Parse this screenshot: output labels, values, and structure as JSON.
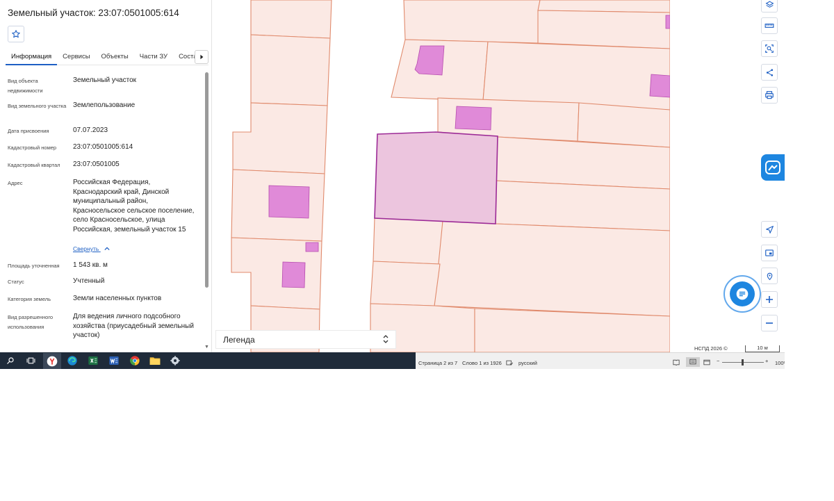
{
  "panel": {
    "title": "Земельный участок: 23:07:0501005:614",
    "tabs": [
      {
        "label": "Информация",
        "active": true
      },
      {
        "label": "Сервисы",
        "active": false
      },
      {
        "label": "Объекты",
        "active": false
      },
      {
        "label": "Части ЗУ",
        "active": false
      },
      {
        "label": "Состав",
        "active": false
      }
    ],
    "properties": [
      {
        "label": "Вид объекта недвижимости",
        "value": "Земельный участок"
      },
      {
        "label": "Вид земельного участка",
        "value": "Землепользование"
      },
      {
        "label": "Дата присвоения",
        "value": "07.07.2023"
      },
      {
        "label": "Кадастровый номер",
        "value": "23:07:0501005:614"
      },
      {
        "label": "Кадастровый квартал",
        "value": "23:07:0501005"
      },
      {
        "label": "Адрес",
        "value": "Российская Федерация, Краснодарский край, Динской муниципальный район, Красносельское сельское поселение, село Красносельское, улица Российская, земельный участок 15"
      },
      {
        "label": "Площадь уточненная",
        "value": "1 543 кв. м"
      },
      {
        "label": "Статус",
        "value": "Учтенный"
      },
      {
        "label": "Категория земель",
        "value": "Земли населенных пунктов"
      },
      {
        "label": "Вид разрешенного использования",
        "value": "Для ведения личного подсобного хозяйства (приусадебный земельный участок)"
      }
    ],
    "collapse_label": "Свернуть"
  },
  "map": {
    "legend_label": "Легенда",
    "attribution": "НСПД 2026 ©",
    "scale_label": "10 м",
    "colors": {
      "parcel_fill": "#fbe9e4",
      "parcel_line": "#e08a6c",
      "building": "#e08ad8",
      "selected_fill": "#ecc5de",
      "selected_line": "#9c2a96"
    }
  },
  "statusbar": {
    "page": "Страница 2 из 7",
    "words": "Слово 1 из 1926",
    "language": "русский",
    "zoom": "100%"
  },
  "colors": {
    "accent": "#1d5fc4",
    "taskbar": "#1f2b3a",
    "chat": "#1e86e0"
  }
}
